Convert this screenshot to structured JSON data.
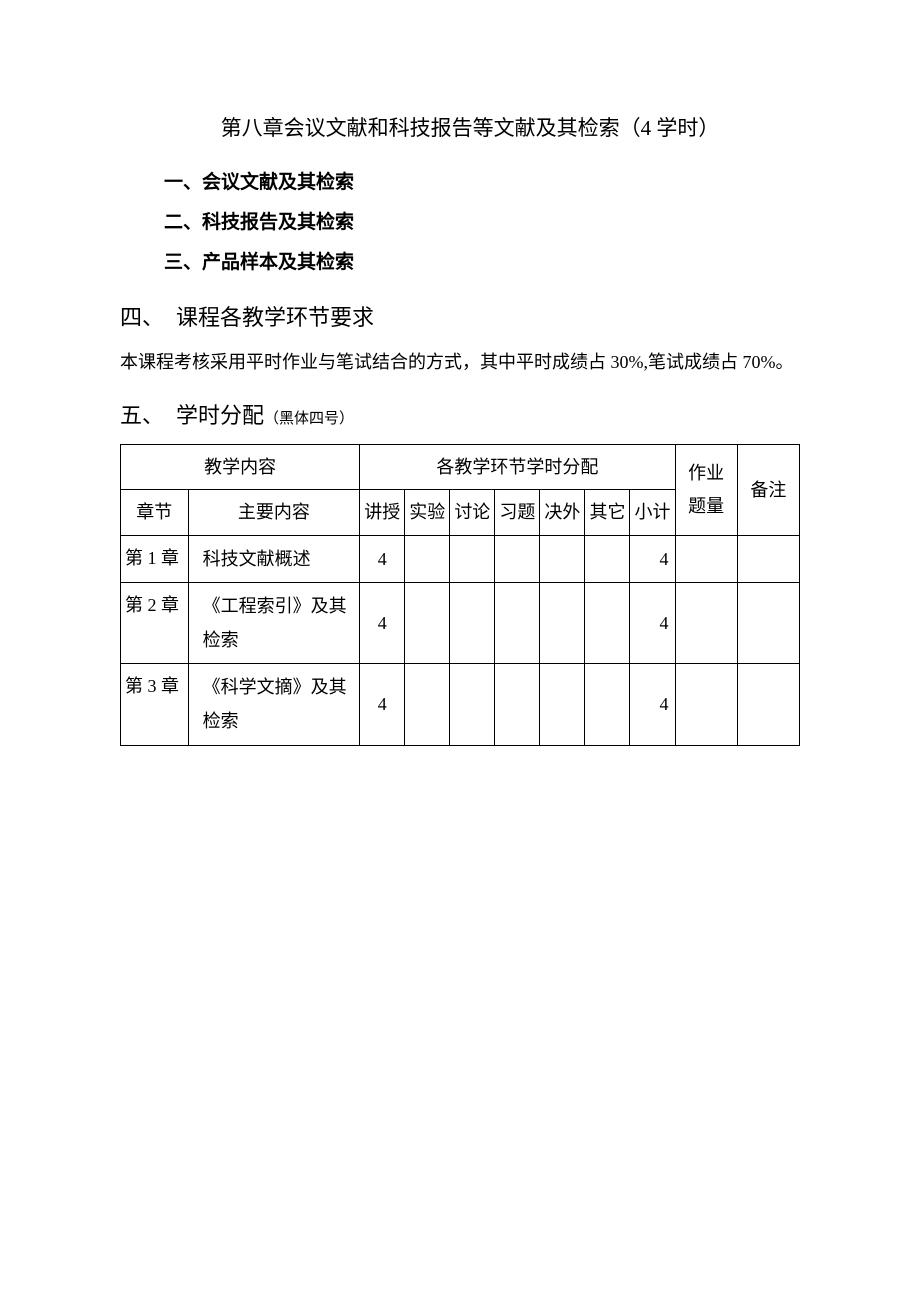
{
  "chapter_title": "第八章会议文献和科技报告等文献及其检索（4 学时）",
  "sub_items": [
    "一、会议文献及其检索",
    "二、科技报告及其检索",
    "三、产品样本及其检索"
  ],
  "section4": {
    "num": "四、",
    "title": "课程各教学环节要求"
  },
  "assessment_text": "本课程考核采用平时作业与笔试结合的方式，其中平时成绩占 30%,笔试成绩占 70%。",
  "section5": {
    "num": "五、",
    "title": "学时分配",
    "note": "（黑体四号）"
  },
  "table": {
    "header_teaching_content": "教学内容",
    "header_allocation": "各教学环节学时分配",
    "header_homework": "作业题量",
    "header_remark": "备注",
    "sub_chapter": "章节",
    "sub_main": "主要内容",
    "sub_lecture": "讲授",
    "sub_experiment": "实验",
    "sub_discussion": "讨论",
    "sub_exercise": "习题",
    "sub_juewai": "决外",
    "sub_other": "其它",
    "sub_subtotal": "小计",
    "rows": [
      {
        "chapter": "第 1 章",
        "main": "科技文献概述",
        "lecture": "4",
        "subtotal": "4"
      },
      {
        "chapter": "第 2 章",
        "main": "《工程索引》及其检索",
        "lecture": "4",
        "subtotal": "4"
      },
      {
        "chapter": "第 3 章",
        "main": "《科学文摘》及其检索",
        "lecture": "4",
        "subtotal": "4"
      }
    ]
  }
}
